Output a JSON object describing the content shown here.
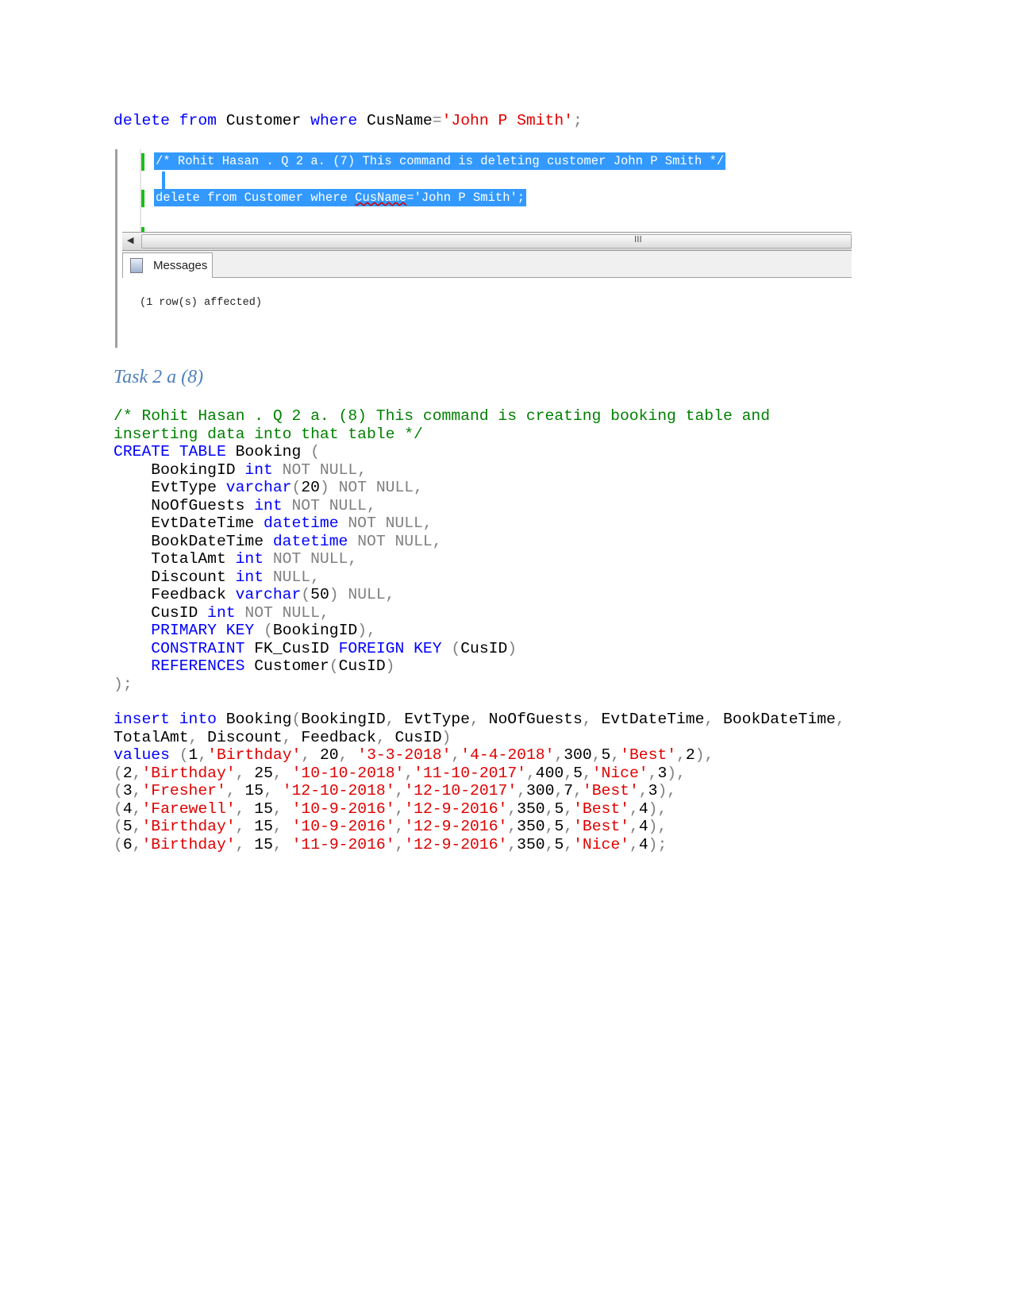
{
  "line1": [
    [
      "k",
      "delete"
    ],
    [
      "t",
      " "
    ],
    [
      "k",
      "from"
    ],
    [
      "t",
      " Customer "
    ],
    [
      "k",
      "where"
    ],
    [
      "t",
      " CusName"
    ],
    [
      "g",
      "="
    ],
    [
      "s",
      "'John P Smith'"
    ],
    [
      "g",
      ";"
    ]
  ],
  "screenshot": {
    "comment_line": "/* Rohit Hasan . Q 2 a. (7) This command is deleting customer John P Smith */",
    "delete_prefix": "delete from Customer where ",
    "delete_squiggle": "CusName",
    "delete_suffix": "='John P Smith';",
    "scroll_grip": "III",
    "tab_label": "Messages",
    "result": "(1 row(s) affected)"
  },
  "heading": "Task 2 a (8)",
  "block1": [
    [
      [
        "c",
        "/* Rohit Hasan . Q 2 a. (8) This command is creating booking table and"
      ]
    ],
    [
      [
        "c",
        "inserting data into that table */"
      ]
    ],
    [
      [
        "k",
        "CREATE TABLE"
      ],
      [
        "t",
        " Booking "
      ],
      [
        "g",
        "("
      ]
    ],
    [
      [
        "t",
        "    BookingID "
      ],
      [
        "k",
        "int"
      ],
      [
        "g",
        " NOT NULL,"
      ]
    ],
    [
      [
        "t",
        "    EvtType "
      ],
      [
        "k",
        "varchar"
      ],
      [
        "g",
        "("
      ],
      [
        "t",
        "20"
      ],
      [
        "g",
        ") NOT NULL,"
      ]
    ],
    [
      [
        "t",
        "    NoOfGuests "
      ],
      [
        "k",
        "int"
      ],
      [
        "g",
        " NOT NULL,"
      ]
    ],
    [
      [
        "t",
        "    EvtDateTime "
      ],
      [
        "k",
        "datetime"
      ],
      [
        "g",
        " NOT NULL,"
      ]
    ],
    [
      [
        "t",
        "    BookDateTime "
      ],
      [
        "k",
        "datetime"
      ],
      [
        "g",
        " NOT NULL,"
      ]
    ],
    [
      [
        "t",
        "    TotalAmt "
      ],
      [
        "k",
        "int"
      ],
      [
        "g",
        " NOT NULL,"
      ]
    ],
    [
      [
        "t",
        "    Discount "
      ],
      [
        "k",
        "int"
      ],
      [
        "g",
        " NULL,"
      ]
    ],
    [
      [
        "t",
        "    Feedback "
      ],
      [
        "k",
        "varchar"
      ],
      [
        "g",
        "("
      ],
      [
        "t",
        "50"
      ],
      [
        "g",
        ") NULL,"
      ]
    ],
    [
      [
        "t",
        "    CusID "
      ],
      [
        "k",
        "int"
      ],
      [
        "g",
        " NOT NULL,"
      ]
    ],
    [
      [
        "t",
        "    "
      ],
      [
        "k",
        "PRIMARY KEY"
      ],
      [
        "g",
        " ("
      ],
      [
        "t",
        "BookingID"
      ],
      [
        "g",
        "),"
      ]
    ],
    [
      [
        "t",
        "    "
      ],
      [
        "k",
        "CONSTRAINT"
      ],
      [
        "t",
        " FK_CusID "
      ],
      [
        "k",
        "FOREIGN KEY"
      ],
      [
        "g",
        " ("
      ],
      [
        "t",
        "CusID"
      ],
      [
        "g",
        ")"
      ]
    ],
    [
      [
        "t",
        "    "
      ],
      [
        "k",
        "REFERENCES"
      ],
      [
        "t",
        " Customer"
      ],
      [
        "g",
        "("
      ],
      [
        "t",
        "CusID"
      ],
      [
        "g",
        ")"
      ]
    ],
    [
      [
        "g",
        ");"
      ]
    ]
  ],
  "block2": [
    [
      [
        "k",
        "insert into"
      ],
      [
        "t",
        " Booking"
      ],
      [
        "g",
        "("
      ],
      [
        "t",
        "BookingID"
      ],
      [
        "g",
        ", "
      ],
      [
        "t",
        "EvtType"
      ],
      [
        "g",
        ", "
      ],
      [
        "t",
        "NoOfGuests"
      ],
      [
        "g",
        ", "
      ],
      [
        "t",
        "EvtDateTime"
      ],
      [
        "g",
        ", "
      ],
      [
        "t",
        "BookDateTime"
      ],
      [
        "g",
        ","
      ]
    ],
    [
      [
        "t",
        "TotalAmt"
      ],
      [
        "g",
        ", "
      ],
      [
        "t",
        "Discount"
      ],
      [
        "g",
        ", "
      ],
      [
        "t",
        "Feedback"
      ],
      [
        "g",
        ", "
      ],
      [
        "t",
        "CusID"
      ],
      [
        "g",
        ")"
      ]
    ],
    [
      [
        "k",
        "values"
      ],
      [
        "g",
        " ("
      ],
      [
        "t",
        "1"
      ],
      [
        "g",
        ","
      ],
      [
        "s",
        "'Birthday'"
      ],
      [
        "g",
        ", "
      ],
      [
        "t",
        "20"
      ],
      [
        "g",
        ", "
      ],
      [
        "s",
        "'3-3-2018'"
      ],
      [
        "g",
        ","
      ],
      [
        "s",
        "'4-4-2018'"
      ],
      [
        "g",
        ","
      ],
      [
        "t",
        "300"
      ],
      [
        "g",
        ","
      ],
      [
        "t",
        "5"
      ],
      [
        "g",
        ","
      ],
      [
        "s",
        "'Best'"
      ],
      [
        "g",
        ","
      ],
      [
        "t",
        "2"
      ],
      [
        "g",
        "),"
      ]
    ],
    [
      [
        "g",
        "("
      ],
      [
        "t",
        "2"
      ],
      [
        "g",
        ","
      ],
      [
        "s",
        "'Birthday'"
      ],
      [
        "g",
        ", "
      ],
      [
        "t",
        "25"
      ],
      [
        "g",
        ", "
      ],
      [
        "s",
        "'10-10-2018'"
      ],
      [
        "g",
        ","
      ],
      [
        "s",
        "'11-10-2017'"
      ],
      [
        "g",
        ","
      ],
      [
        "t",
        "400"
      ],
      [
        "g",
        ","
      ],
      [
        "t",
        "5"
      ],
      [
        "g",
        ","
      ],
      [
        "s",
        "'Nice'"
      ],
      [
        "g",
        ","
      ],
      [
        "t",
        "3"
      ],
      [
        "g",
        "),"
      ]
    ],
    [
      [
        "g",
        "("
      ],
      [
        "t",
        "3"
      ],
      [
        "g",
        ","
      ],
      [
        "s",
        "'Fresher'"
      ],
      [
        "g",
        ", "
      ],
      [
        "t",
        "15"
      ],
      [
        "g",
        ", "
      ],
      [
        "s",
        "'12-10-2018'"
      ],
      [
        "g",
        ","
      ],
      [
        "s",
        "'12-10-2017'"
      ],
      [
        "g",
        ","
      ],
      [
        "t",
        "300"
      ],
      [
        "g",
        ","
      ],
      [
        "t",
        "7"
      ],
      [
        "g",
        ","
      ],
      [
        "s",
        "'Best'"
      ],
      [
        "g",
        ","
      ],
      [
        "t",
        "3"
      ],
      [
        "g",
        "),"
      ]
    ],
    [
      [
        "g",
        "("
      ],
      [
        "t",
        "4"
      ],
      [
        "g",
        ","
      ],
      [
        "s",
        "'Farewell'"
      ],
      [
        "g",
        ", "
      ],
      [
        "t",
        "15"
      ],
      [
        "g",
        ", "
      ],
      [
        "s",
        "'10-9-2016'"
      ],
      [
        "g",
        ","
      ],
      [
        "s",
        "'12-9-2016'"
      ],
      [
        "g",
        ","
      ],
      [
        "t",
        "350"
      ],
      [
        "g",
        ","
      ],
      [
        "t",
        "5"
      ],
      [
        "g",
        ","
      ],
      [
        "s",
        "'Best'"
      ],
      [
        "g",
        ","
      ],
      [
        "t",
        "4"
      ],
      [
        "g",
        "),"
      ]
    ],
    [
      [
        "g",
        "("
      ],
      [
        "t",
        "5"
      ],
      [
        "g",
        ","
      ],
      [
        "s",
        "'Birthday'"
      ],
      [
        "g",
        ", "
      ],
      [
        "t",
        "15"
      ],
      [
        "g",
        ", "
      ],
      [
        "s",
        "'10-9-2016'"
      ],
      [
        "g",
        ","
      ],
      [
        "s",
        "'12-9-2016'"
      ],
      [
        "g",
        ","
      ],
      [
        "t",
        "350"
      ],
      [
        "g",
        ","
      ],
      [
        "t",
        "5"
      ],
      [
        "g",
        ","
      ],
      [
        "s",
        "'Best'"
      ],
      [
        "g",
        ","
      ],
      [
        "t",
        "4"
      ],
      [
        "g",
        "),"
      ]
    ],
    [
      [
        "g",
        "("
      ],
      [
        "t",
        "6"
      ],
      [
        "g",
        ","
      ],
      [
        "s",
        "'Birthday'"
      ],
      [
        "g",
        ", "
      ],
      [
        "t",
        "15"
      ],
      [
        "g",
        ", "
      ],
      [
        "s",
        "'11-9-2016'"
      ],
      [
        "g",
        ","
      ],
      [
        "s",
        "'12-9-2016'"
      ],
      [
        "g",
        ","
      ],
      [
        "t",
        "350"
      ],
      [
        "g",
        ","
      ],
      [
        "t",
        "5"
      ],
      [
        "g",
        ","
      ],
      [
        "s",
        "'Nice'"
      ],
      [
        "g",
        ","
      ],
      [
        "t",
        "4"
      ],
      [
        "g",
        ");"
      ]
    ]
  ]
}
